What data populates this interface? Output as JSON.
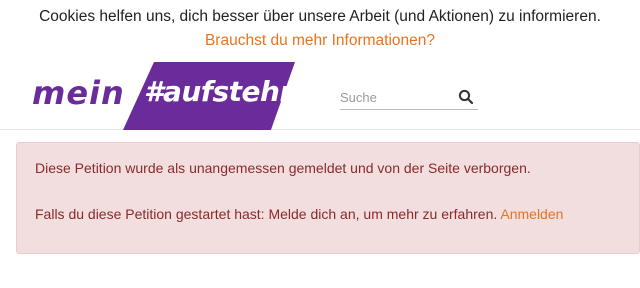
{
  "cookie_banner": {
    "message": "Cookies helfen uns, dich besser über unsere Arbeit (und Aktionen) zu informieren.",
    "link_text": "Brauchst du mehr Informationen?"
  },
  "header": {
    "logo_part1": "mein",
    "logo_part2": "#aufstehn",
    "search_placeholder": "Suche"
  },
  "alert": {
    "line1": "Diese Petition wurde als unangemessen gemeldet und von der Seite verborgen.",
    "line2": "Falls du diese Petition gestartet hast: Melde dich an, um mehr zu erfahren.",
    "login_link": "Anmelden"
  },
  "colors": {
    "brand_purple": "#6a2c9b",
    "accent_orange": "#e8731f",
    "alert_background": "#f2dede",
    "alert_text": "#8a2a2a"
  },
  "icons": {
    "search": "search-icon"
  }
}
